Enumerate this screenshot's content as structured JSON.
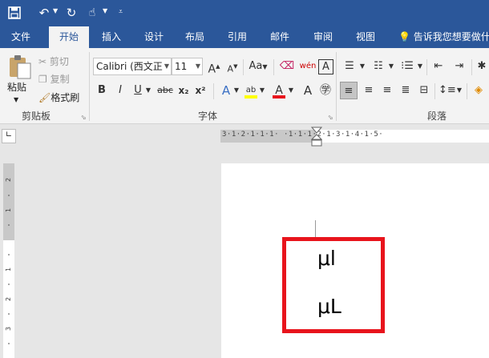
{
  "qat": {
    "icons": [
      "save-icon",
      "undo-icon",
      "redo-icon",
      "touch-mode-icon",
      "customize-icon"
    ]
  },
  "tabs": [
    {
      "label": "文件"
    },
    {
      "label": "开始"
    },
    {
      "label": "插入"
    },
    {
      "label": "设计"
    },
    {
      "label": "布局"
    },
    {
      "label": "引用"
    },
    {
      "label": "邮件"
    },
    {
      "label": "审阅"
    },
    {
      "label": "视图"
    }
  ],
  "active_tab": "开始",
  "tell_me": "告诉我您想要做什",
  "clipboard": {
    "paste": "粘贴",
    "cut": "剪切",
    "copy": "复制",
    "format_painter": "格式刷",
    "group": "剪贴板"
  },
  "font": {
    "name": "Calibri (西文正",
    "size": "11",
    "grow": "A",
    "shrink": "A",
    "case": "Aa",
    "bold": "B",
    "italic": "I",
    "underline": "U",
    "strike": "abc",
    "subscript": "x₂",
    "superscript": "x²",
    "group": "字体"
  },
  "paragraph": {
    "group": "段落"
  },
  "ruler": {
    "text": "3·1·2·1·1·1· ·1·1·1·2·1·3·1·4·1·5·"
  },
  "document": {
    "line1": "μl",
    "line2": "μL"
  },
  "colors": {
    "ribbon": "#2b579a",
    "highlight_box": "#e8141c"
  }
}
